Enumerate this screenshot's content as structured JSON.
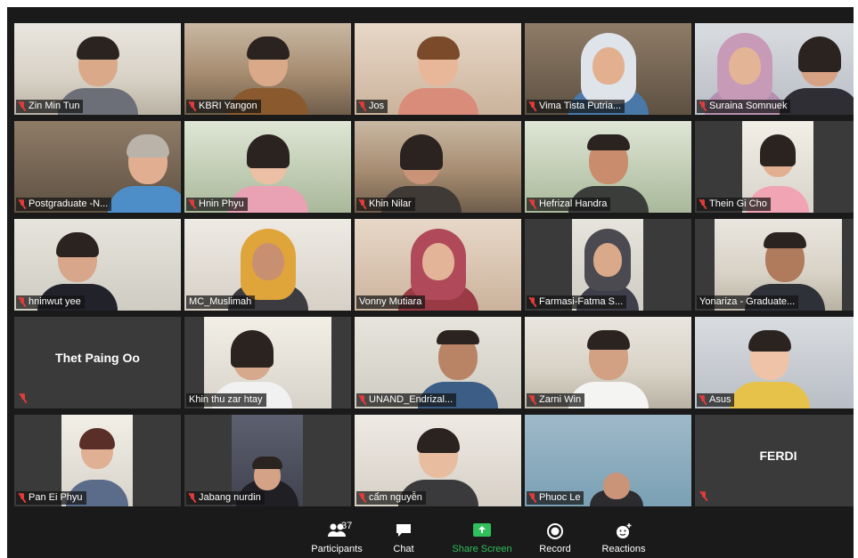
{
  "participants": [
    {
      "name": "Zin Min Tun",
      "muted": true
    },
    {
      "name": "KBRI Yangon",
      "muted": true
    },
    {
      "name": "Jos",
      "muted": true
    },
    {
      "name": "Vima Tista Putria...",
      "muted": true
    },
    {
      "name": "Suraina Somnuek",
      "muted": true
    },
    {
      "name": "Postgraduate -N...",
      "muted": true
    },
    {
      "name": "Hnin Phyu",
      "muted": true
    },
    {
      "name": "Khin Nilar",
      "muted": true
    },
    {
      "name": "Hefrizal Handra",
      "muted": true
    },
    {
      "name": "Thein Gi Cho",
      "muted": true
    },
    {
      "name": "hninwut yee",
      "muted": true
    },
    {
      "name": "MC_Muslimah",
      "muted": false,
      "active_speaker": true
    },
    {
      "name": "Vonny Mutiara",
      "muted": false
    },
    {
      "name": "Farmasi-Fatma S...",
      "muted": true
    },
    {
      "name": "Yonariza - Graduate...",
      "muted": false
    },
    {
      "name": "Thet Paing Oo",
      "muted": true,
      "video_off": true
    },
    {
      "name": "Khin thu zar htay",
      "muted": false
    },
    {
      "name": "UNAND_Endrizal...",
      "muted": true
    },
    {
      "name": "Zarni Win",
      "muted": true
    },
    {
      "name": "Asus",
      "muted": true
    },
    {
      "name": "Pan Ei Phyu",
      "muted": true
    },
    {
      "name": "Jabang nurdin",
      "muted": true
    },
    {
      "name": "cẩm nguyễn",
      "muted": true
    },
    {
      "name": "Phuoc Le",
      "muted": true
    },
    {
      "name": "FERDI",
      "muted": true,
      "video_off": true
    }
  ],
  "toolbar": {
    "participants_label": "Participants",
    "participants_count": "37",
    "chat_label": "Chat",
    "share_label": "Share Screen",
    "record_label": "Record",
    "reactions_label": "Reactions"
  },
  "colors": {
    "background": "#1a1a1a",
    "tile": "#3a3a3a",
    "active_border": "#c9d64b",
    "muted_red": "#e23b3b",
    "share_green": "#2fbf5b"
  }
}
